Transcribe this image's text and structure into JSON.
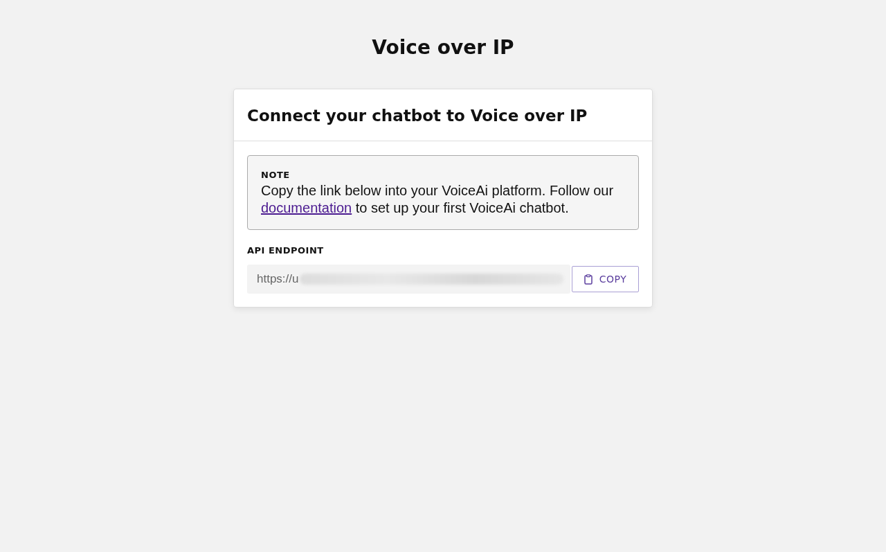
{
  "page_title": "Voice over IP",
  "card": {
    "title": "Connect your chatbot to Voice over IP",
    "note": {
      "label": "NOTE",
      "text_before": "Copy the link below into your VoiceAi platform. Follow our ",
      "link": "documentation",
      "text_after": " to set up your first VoiceAi chatbot."
    },
    "endpoint": {
      "label": "API ENDPOINT",
      "value": "https://u",
      "redacted": true,
      "button": "COPY"
    }
  }
}
